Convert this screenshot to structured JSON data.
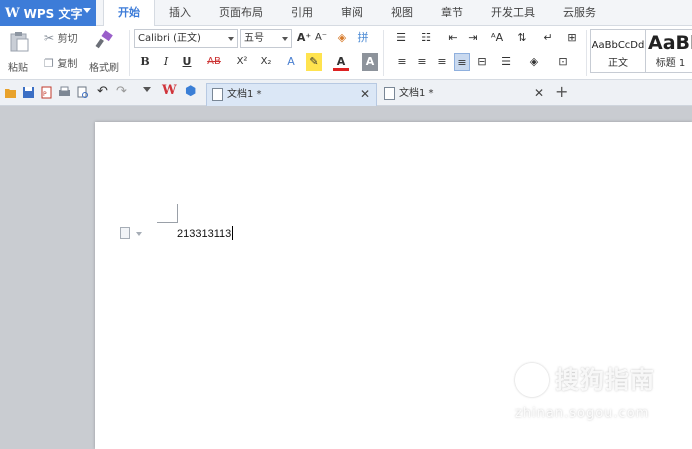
{
  "app": {
    "name": "WPS 文字",
    "logo": "W"
  },
  "menu_tabs": [
    {
      "label": "开始",
      "active": true
    },
    {
      "label": "插入"
    },
    {
      "label": "页面布局"
    },
    {
      "label": "引用"
    },
    {
      "label": "审阅"
    },
    {
      "label": "视图"
    },
    {
      "label": "章节"
    },
    {
      "label": "开发工具"
    },
    {
      "label": "云服务"
    }
  ],
  "clipboard": {
    "paste": "粘贴",
    "cut": "剪切",
    "copy": "复制",
    "format_painter": "格式刷"
  },
  "font": {
    "family": "Calibri (正文)",
    "size": "五号",
    "grow": "A⁺",
    "shrink": "A⁻"
  },
  "format_buttons": {
    "bold": "B",
    "italic": "I",
    "underline": "U",
    "strike": "AB",
    "superscript": "X²",
    "subscript": "X₂",
    "font_color": "A"
  },
  "styles": [
    {
      "preview": "AaBbCcDd",
      "name": "正文"
    },
    {
      "preview": "AaBl",
      "name": "标题 1"
    }
  ],
  "doc_tabs": [
    {
      "label": "文档1 *",
      "active": true
    },
    {
      "label": "文档1 *",
      "active": false
    }
  ],
  "document": {
    "text": "213313113"
  },
  "watermark": {
    "text": "搜狗指南",
    "url": "zhinan.sogou.com"
  },
  "colors": {
    "accent": "#3d7cd8",
    "workspace": "#c9ccd1"
  }
}
